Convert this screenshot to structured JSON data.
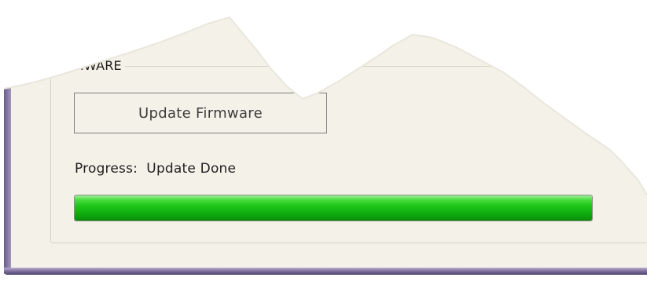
{
  "group": {
    "title": "‹RMWARE"
  },
  "buttons": {
    "update_firmware_label": "Update Firmware"
  },
  "progress": {
    "label": "Progress:",
    "status": "Update Done",
    "value_percent": 100,
    "fill_color": "#12b812"
  },
  "colors": {
    "window_background": "#f4f2e8",
    "window_frame": "#6b5b8a"
  }
}
